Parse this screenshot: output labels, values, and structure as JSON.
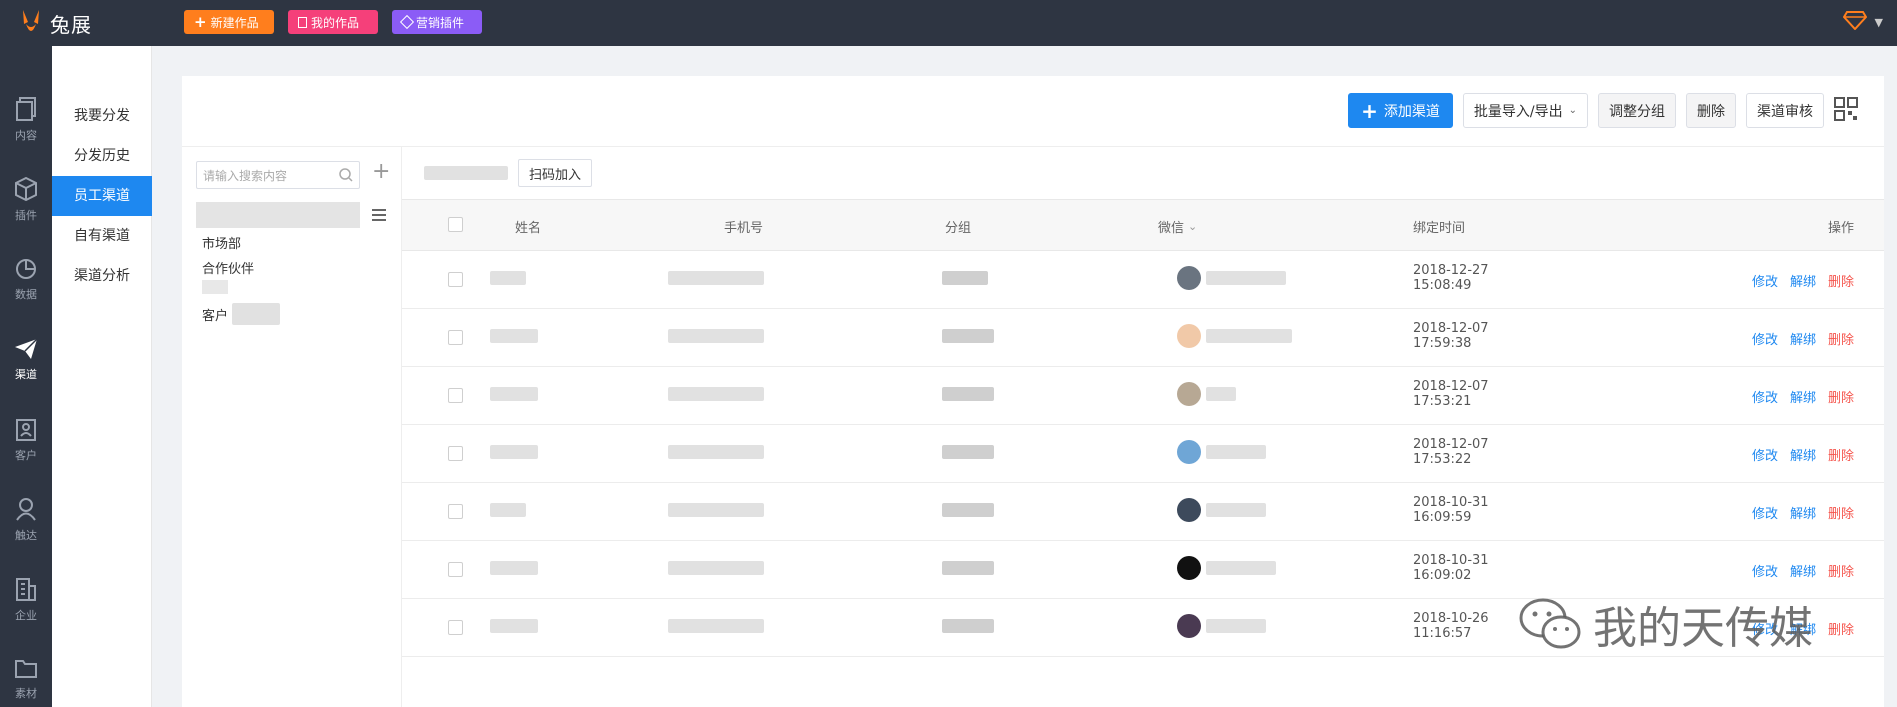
{
  "topbar": {
    "logo_text": "兔展",
    "new_work": "新建作品",
    "my_works": "我的作品",
    "marketing": "营销插件"
  },
  "rail": [
    {
      "label": "内容",
      "icon": "content-icon"
    },
    {
      "label": "插件",
      "icon": "plugin-icon"
    },
    {
      "label": "数据",
      "icon": "data-icon"
    },
    {
      "label": "渠道",
      "icon": "channel-icon"
    },
    {
      "label": "客户",
      "icon": "customer-icon"
    },
    {
      "label": "触达",
      "icon": "reach-icon"
    },
    {
      "label": "企业",
      "icon": "enterprise-icon"
    },
    {
      "label": "素材",
      "icon": "material-icon"
    }
  ],
  "subnav": [
    "我要分发",
    "分发历史",
    "员工渠道",
    "自有渠道",
    "渠道分析"
  ],
  "toolbar": {
    "add": "添加渠道",
    "batch": "批量导入/导出",
    "adjust": "调整分组",
    "delete": "删除",
    "audit": "渠道审核"
  },
  "groups": {
    "search_placeholder": "请输入搜索内容",
    "g1": "市场部",
    "g2": "合作伙伴",
    "g3": "客户"
  },
  "table": {
    "scan": "扫码加入",
    "headers": {
      "name": "姓名",
      "phone": "手机号",
      "group": "分组",
      "wechat": "微信",
      "time": "绑定时间",
      "ops": "操作"
    },
    "rows": [
      {
        "date": "2018-12-27",
        "clock": "15:08:49"
      },
      {
        "date": "2018-12-07",
        "clock": "17:59:38"
      },
      {
        "date": "2018-12-07",
        "clock": "17:53:21"
      },
      {
        "date": "2018-12-07",
        "clock": "17:53:22"
      },
      {
        "date": "2018-10-31",
        "clock": "16:09:59"
      },
      {
        "date": "2018-10-31",
        "clock": "16:09:02"
      },
      {
        "date": "2018-10-26",
        "clock": "11:16:57"
      }
    ],
    "op_edit": "修改",
    "op_unbind": "解绑",
    "op_delete": "删除"
  },
  "watermark": "我的天传媒",
  "colors": {
    "accent": "#1e88f0",
    "danger": "#f5544c",
    "dark": "#2e3542",
    "orange": "#ff7e1d",
    "pink": "#f5407a",
    "purple": "#8b5cf6"
  }
}
